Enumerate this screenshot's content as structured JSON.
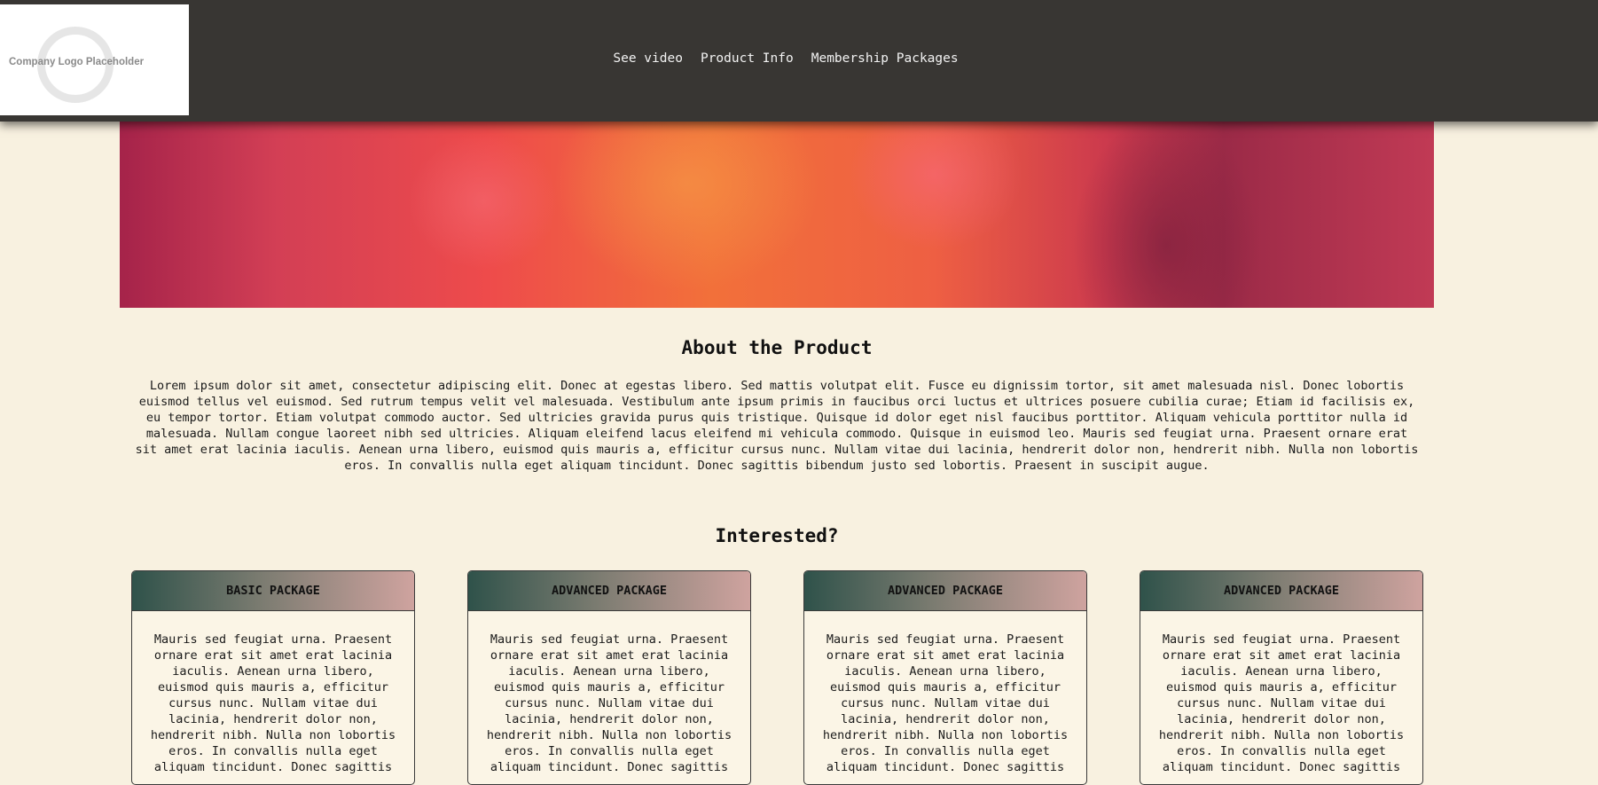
{
  "header": {
    "logo_text": "Company Logo Placeholder",
    "nav": [
      {
        "label": "See video"
      },
      {
        "label": "Product Info"
      },
      {
        "label": "Membership Packages"
      }
    ]
  },
  "about": {
    "title": "About the Product",
    "text": "Lorem ipsum dolor sit amet, consectetur adipiscing elit. Donec at egestas libero. Sed mattis volutpat elit. Fusce eu dignissim tortor, sit amet malesuada nisl. Donec lobortis euismod tellus vel euismod. Sed rutrum tempus velit vel malesuada. Vestibulum ante ipsum primis in faucibus orci luctus et ultrices posuere cubilia curae; Etiam id facilisis ex, eu tempor tortor. Etiam volutpat commodo auctor. Sed ultricies gravida purus quis tristique. Quisque id dolor eget nisl faucibus porttitor. Aliquam vehicula porttitor nulla id malesuada. Nullam congue laoreet nibh sed ultricies. Aliquam eleifend lacus eleifend mi vehicula commodo. Quisque in euismod leo. Mauris sed feugiat urna. Praesent ornare erat sit amet erat lacinia iaculis. Aenean urna libero, euismod quis mauris a, efficitur cursus nunc. Nullam vitae dui lacinia, hendrerit dolor non, hendrerit nibh. Nulla non lobortis eros. In convallis nulla eget aliquam tincidunt. Donec sagittis bibendum justo sed lobortis. Praesent in suscipit augue."
  },
  "packages": {
    "title": "Interested?",
    "cards": [
      {
        "title": "BASIC PACKAGE",
        "text": "Mauris sed feugiat urna. Praesent ornare erat sit amet erat lacinia iaculis. Aenean urna libero, euismod quis mauris a, efficitur cursus nunc. Nullam vitae dui lacinia, hendrerit dolor non, hendrerit nibh. Nulla non lobortis eros. In convallis nulla eget aliquam tincidunt. Donec sagittis"
      },
      {
        "title": "ADVANCED PACKAGE",
        "text": "Mauris sed feugiat urna. Praesent ornare erat sit amet erat lacinia iaculis. Aenean urna libero, euismod quis mauris a, efficitur cursus nunc. Nullam vitae dui lacinia, hendrerit dolor non, hendrerit nibh. Nulla non lobortis eros. In convallis nulla eget aliquam tincidunt. Donec sagittis"
      },
      {
        "title": "ADVANCED PACKAGE",
        "text": "Mauris sed feugiat urna. Praesent ornare erat sit amet erat lacinia iaculis. Aenean urna libero, euismod quis mauris a, efficitur cursus nunc. Nullam vitae dui lacinia, hendrerit dolor non, hendrerit nibh. Nulla non lobortis eros. In convallis nulla eget aliquam tincidunt. Donec sagittis"
      },
      {
        "title": "ADVANCED PACKAGE",
        "text": "Mauris sed feugiat urna. Praesent ornare erat sit amet erat lacinia iaculis. Aenean urna libero, euismod quis mauris a, efficitur cursus nunc. Nullam vitae dui lacinia, hendrerit dolor non, hendrerit nibh. Nulla non lobortis eros. In convallis nulla eget aliquam tincidunt. Donec sagittis"
      }
    ]
  }
}
